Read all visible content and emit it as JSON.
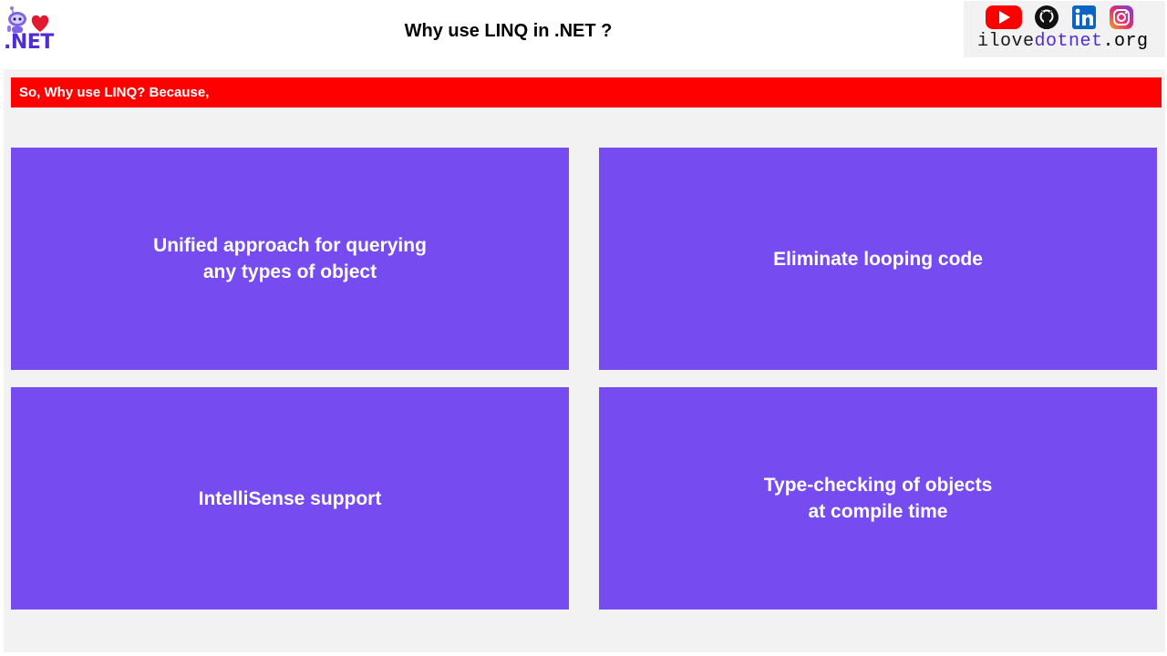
{
  "header": {
    "logo_text": ".NET",
    "title": "Why use LINQ in .NET ?"
  },
  "brand": {
    "url_parts": [
      "i",
      "love",
      "dotnet",
      ".org"
    ],
    "icons": [
      "youtube-icon",
      "github-icon",
      "linkedin-icon",
      "instagram-icon"
    ]
  },
  "banner": {
    "text": "So, Why use LINQ? Because,"
  },
  "cards": [
    {
      "text": "Unified approach for querying\nany types of object"
    },
    {
      "text": "Eliminate looping code"
    },
    {
      "text": "IntelliSense support"
    },
    {
      "text": "Type-checking of objects\nat compile time"
    }
  ],
  "colors": {
    "banner": "#ff0000",
    "card": "#764bf0",
    "panel": "#f2f2f2",
    "brand_purple": "#512bd4"
  }
}
